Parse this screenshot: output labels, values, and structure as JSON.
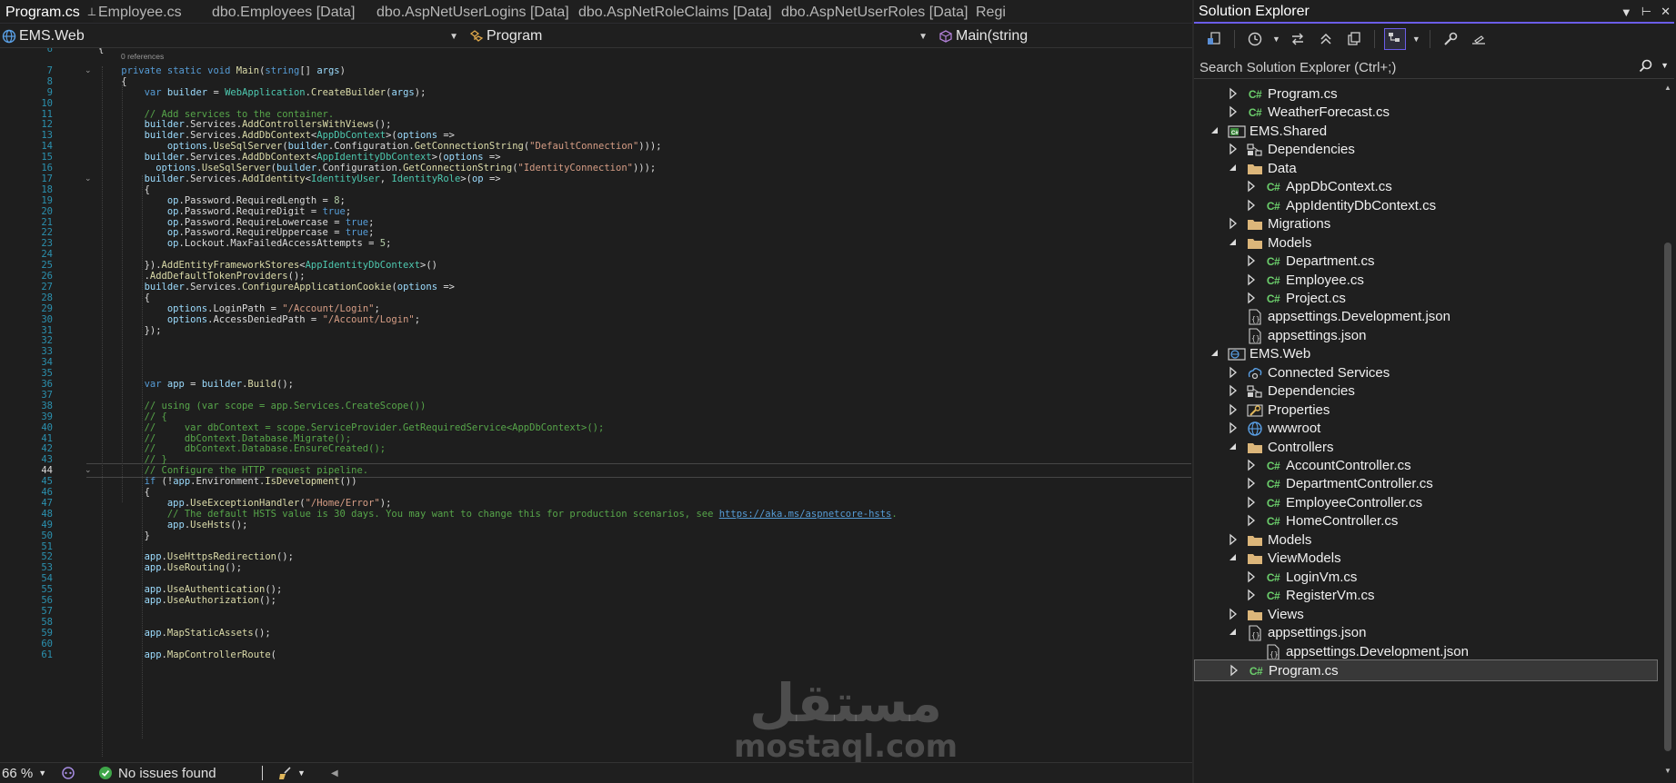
{
  "tabs": [
    {
      "label": "Program.cs",
      "active": true,
      "pinned": true
    },
    {
      "label": "Employee.cs"
    },
    {
      "label": "dbo.Employees [Data]"
    },
    {
      "label": "dbo.AspNetUserLogins [Data]"
    },
    {
      "label": "dbo.AspNetRoleClaims [Data]"
    },
    {
      "label": "dbo.AspNetUserRoles [Data]"
    },
    {
      "label": "Regi"
    }
  ],
  "navbar": {
    "project": "EMS.Web",
    "type": "Program",
    "member": "Main(string"
  },
  "editor": {
    "references": "0 references",
    "current_line": 44,
    "lines": [
      {
        "n": 6,
        "t": "{"
      },
      {
        "n": 7,
        "t": "    private static void Main(string[] args)"
      },
      {
        "n": 8,
        "t": "    {"
      },
      {
        "n": 9,
        "t": "        var builder = WebApplication.CreateBuilder(args);"
      },
      {
        "n": 10,
        "t": ""
      },
      {
        "n": 11,
        "t": "        // Add services to the container."
      },
      {
        "n": 12,
        "t": "        builder.Services.AddControllersWithViews();"
      },
      {
        "n": 13,
        "t": "        builder.Services.AddDbContext<AppDbContext>(options =>"
      },
      {
        "n": 14,
        "t": "            options.UseSqlServer(builder.Configuration.GetConnectionString(\"DefaultConnection\")));"
      },
      {
        "n": 15,
        "t": "        builder.Services.AddDbContext<AppIdentityDbContext>(options =>"
      },
      {
        "n": 16,
        "t": "          options.UseSqlServer(builder.Configuration.GetConnectionString(\"IdentityConnection\")));"
      },
      {
        "n": 17,
        "t": "        builder.Services.AddIdentity<IdentityUser, IdentityRole>(op =>"
      },
      {
        "n": 18,
        "t": "        {"
      },
      {
        "n": 19,
        "t": "            op.Password.RequiredLength = 8;"
      },
      {
        "n": 20,
        "t": "            op.Password.RequireDigit = true;"
      },
      {
        "n": 21,
        "t": "            op.Password.RequireLowercase = true;"
      },
      {
        "n": 22,
        "t": "            op.Password.RequireUppercase = true;"
      },
      {
        "n": 23,
        "t": "            op.Lockout.MaxFailedAccessAttempts = 5;"
      },
      {
        "n": 24,
        "t": ""
      },
      {
        "n": 25,
        "t": "        }).AddEntityFrameworkStores<AppIdentityDbContext>()"
      },
      {
        "n": 26,
        "t": "        .AddDefaultTokenProviders();"
      },
      {
        "n": 27,
        "t": "        builder.Services.ConfigureApplicationCookie(options =>"
      },
      {
        "n": 28,
        "t": "        {"
      },
      {
        "n": 29,
        "t": "            options.LoginPath = \"/Account/Login\";"
      },
      {
        "n": 30,
        "t": "            options.AccessDeniedPath = \"/Account/Login\";"
      },
      {
        "n": 31,
        "t": "        });"
      },
      {
        "n": 32,
        "t": ""
      },
      {
        "n": 33,
        "t": ""
      },
      {
        "n": 34,
        "t": ""
      },
      {
        "n": 35,
        "t": ""
      },
      {
        "n": 36,
        "t": "        var app = builder.Build();"
      },
      {
        "n": 37,
        "t": ""
      },
      {
        "n": 38,
        "t": "        // using (var scope = app.Services.CreateScope())"
      },
      {
        "n": 39,
        "t": "        // {"
      },
      {
        "n": 40,
        "t": "        //     var dbContext = scope.ServiceProvider.GetRequiredService<AppDbContext>();"
      },
      {
        "n": 41,
        "t": "        //     dbContext.Database.Migrate();"
      },
      {
        "n": 42,
        "t": "        //     dbContext.Database.EnsureCreated();"
      },
      {
        "n": 43,
        "t": "        // }"
      },
      {
        "n": 44,
        "t": "        // Configure the HTTP request pipeline."
      },
      {
        "n": 45,
        "t": "        if (!app.Environment.IsDevelopment())"
      },
      {
        "n": 46,
        "t": "        {"
      },
      {
        "n": 47,
        "t": "            app.UseExceptionHandler(\"/Home/Error\");"
      },
      {
        "n": 48,
        "t": "            // The default HSTS value is 30 days. You may want to change this for production scenarios, see https://aka.ms/aspnetcore-hsts."
      },
      {
        "n": 49,
        "t": "            app.UseHsts();"
      },
      {
        "n": 50,
        "t": "        }"
      },
      {
        "n": 51,
        "t": ""
      },
      {
        "n": 52,
        "t": "        app.UseHttpsRedirection();"
      },
      {
        "n": 53,
        "t": "        app.UseRouting();"
      },
      {
        "n": 54,
        "t": ""
      },
      {
        "n": 55,
        "t": "        app.UseAuthentication();"
      },
      {
        "n": 56,
        "t": "        app.UseAuthorization();"
      },
      {
        "n": 57,
        "t": ""
      },
      {
        "n": 58,
        "t": ""
      },
      {
        "n": 59,
        "t": "        app.MapStaticAssets();"
      },
      {
        "n": 60,
        "t": ""
      },
      {
        "n": 61,
        "t": "        app.MapControllerRoute("
      }
    ]
  },
  "statusbar": {
    "zoom": "66 %",
    "issues": "No issues found"
  },
  "watermark": {
    "arabic": "مستقل",
    "latin": "mostaql.com"
  },
  "solution_explorer": {
    "title": "Solution Explorer",
    "search_placeholder": "Search Solution Explorer (Ctrl+;)",
    "tree": [
      {
        "label": "Program.cs",
        "icon": "csharp",
        "depth": 2,
        "expand": "collapsed"
      },
      {
        "label": "WeatherForecast.cs",
        "icon": "csharp",
        "depth": 2,
        "expand": "collapsed"
      },
      {
        "label": "EMS.Shared",
        "icon": "project",
        "depth": 1,
        "expand": "expanded"
      },
      {
        "label": "Dependencies",
        "icon": "dependencies",
        "depth": 2,
        "expand": "collapsed"
      },
      {
        "label": "Data",
        "icon": "folder",
        "depth": 2,
        "expand": "expanded"
      },
      {
        "label": "AppDbContext.cs",
        "icon": "csharp",
        "depth": 3,
        "expand": "collapsed"
      },
      {
        "label": "AppIdentityDbContext.cs",
        "icon": "csharp",
        "depth": 3,
        "expand": "collapsed"
      },
      {
        "label": "Migrations",
        "icon": "folder",
        "depth": 2,
        "expand": "collapsed"
      },
      {
        "label": "Models",
        "icon": "folder",
        "depth": 2,
        "expand": "expanded"
      },
      {
        "label": "Department.cs",
        "icon": "csharp",
        "depth": 3,
        "expand": "collapsed"
      },
      {
        "label": "Employee.cs",
        "icon": "csharp",
        "depth": 3,
        "expand": "collapsed"
      },
      {
        "label": "Project.cs",
        "icon": "csharp",
        "depth": 3,
        "expand": "collapsed"
      },
      {
        "label": "appsettings.Development.json",
        "icon": "json",
        "depth": 2,
        "expand": "none"
      },
      {
        "label": "appsettings.json",
        "icon": "json",
        "depth": 2,
        "expand": "none"
      },
      {
        "label": "EMS.Web",
        "icon": "web-project",
        "depth": 1,
        "expand": "expanded"
      },
      {
        "label": "Connected Services",
        "icon": "connected-services",
        "depth": 2,
        "expand": "collapsed"
      },
      {
        "label": "Dependencies",
        "icon": "dependencies",
        "depth": 2,
        "expand": "collapsed"
      },
      {
        "label": "Properties",
        "icon": "properties",
        "depth": 2,
        "expand": "collapsed"
      },
      {
        "label": "wwwroot",
        "icon": "globe",
        "depth": 2,
        "expand": "collapsed"
      },
      {
        "label": "Controllers",
        "icon": "folder",
        "depth": 2,
        "expand": "expanded"
      },
      {
        "label": "AccountController.cs",
        "icon": "csharp",
        "depth": 3,
        "expand": "collapsed"
      },
      {
        "label": "DepartmentController.cs",
        "icon": "csharp",
        "depth": 3,
        "expand": "collapsed"
      },
      {
        "label": "EmployeeController.cs",
        "icon": "csharp",
        "depth": 3,
        "expand": "collapsed"
      },
      {
        "label": "HomeController.cs",
        "icon": "csharp",
        "depth": 3,
        "expand": "collapsed"
      },
      {
        "label": "Models",
        "icon": "folder",
        "depth": 2,
        "expand": "collapsed"
      },
      {
        "label": "ViewModels",
        "icon": "folder",
        "depth": 2,
        "expand": "expanded"
      },
      {
        "label": "LoginVm.cs",
        "icon": "csharp",
        "depth": 3,
        "expand": "collapsed"
      },
      {
        "label": "RegisterVm.cs",
        "icon": "csharp",
        "depth": 3,
        "expand": "collapsed"
      },
      {
        "label": "Views",
        "icon": "folder",
        "depth": 2,
        "expand": "collapsed"
      },
      {
        "label": "appsettings.json",
        "icon": "json",
        "depth": 2,
        "expand": "expanded"
      },
      {
        "label": "appsettings.Development.json",
        "icon": "json",
        "depth": 3,
        "expand": "none"
      },
      {
        "label": "Program.cs",
        "icon": "csharp",
        "depth": 2,
        "expand": "collapsed",
        "selected": true
      }
    ]
  },
  "colors": {
    "accent": "#6b5de8",
    "keyword": "#569cd6",
    "type": "#4ec9b0",
    "method": "#dcdcaa",
    "string": "#d69d85",
    "comment": "#57a64a",
    "csharp_icon": "#6ccf6c",
    "folder": "#dcb67a"
  }
}
